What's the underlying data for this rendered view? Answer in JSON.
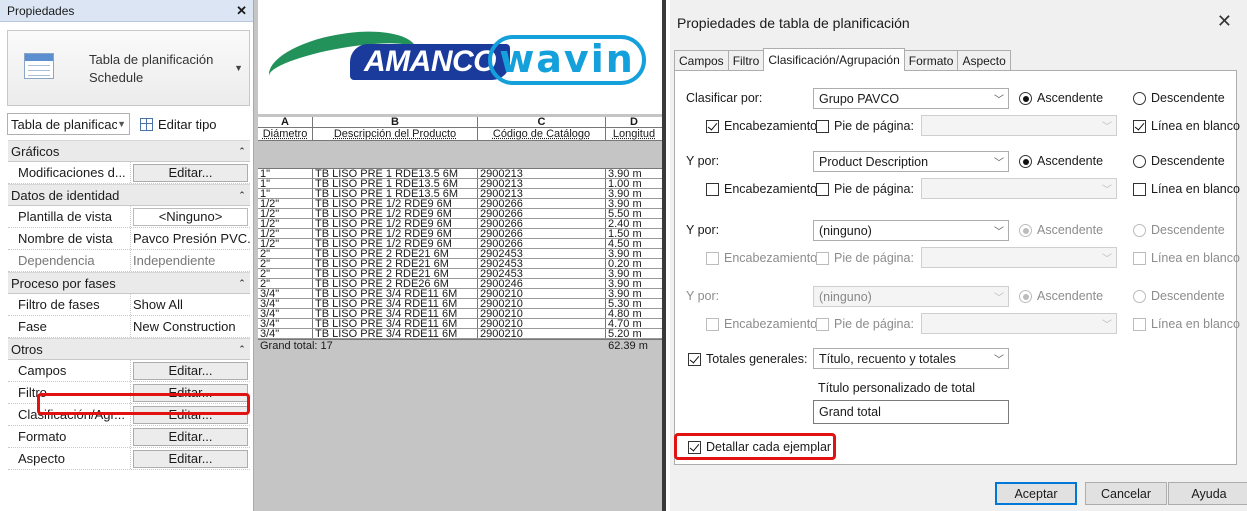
{
  "properties_palette": {
    "title": "Propiedades",
    "type_name_line1": "Tabla de planificación",
    "type_name_line2": "Schedule",
    "instance_selector": "Tabla de planificació",
    "edit_type_label": "Editar tipo",
    "groups": [
      {
        "name": "Gráficos",
        "rows": [
          {
            "name": "Modificaciones d...",
            "value": "Editar...",
            "kind": "button"
          }
        ]
      },
      {
        "name": "Datos de identidad",
        "rows": [
          {
            "name": "Plantilla de vista",
            "value": "<Ninguno>",
            "kind": "button-plain"
          },
          {
            "name": "Nombre de vista",
            "value": "Pavco Presión PVC...",
            "kind": "text"
          },
          {
            "name": "Dependencia",
            "value": "Independiente",
            "kind": "dim"
          }
        ]
      },
      {
        "name": "Proceso por fases",
        "rows": [
          {
            "name": "Filtro de fases",
            "value": "Show All",
            "kind": "text"
          },
          {
            "name": "Fase",
            "value": "New Construction",
            "kind": "text"
          }
        ]
      },
      {
        "name": "Otros",
        "rows": [
          {
            "name": "Campos",
            "value": "Editar...",
            "kind": "button"
          },
          {
            "name": "Filtro",
            "value": "Editar...",
            "kind": "button"
          },
          {
            "name": "Clasificación/Agr...",
            "value": "Editar...",
            "kind": "button"
          },
          {
            "name": "Formato",
            "value": "Editar...",
            "kind": "button"
          },
          {
            "name": "Aspecto",
            "value": "Editar...",
            "kind": "button"
          }
        ]
      }
    ]
  },
  "schedule": {
    "logo_left": "AMANCO",
    "logo_right": "wavin",
    "column_letters": [
      "A",
      "B",
      "C",
      "D"
    ],
    "column_headers": [
      "Diámetro",
      "Descripción del Producto",
      "Código de Catálogo",
      "Longitud"
    ],
    "rows": [
      [
        "1\"",
        "TB LISO PRE 1 RDE13.5 6M",
        "2900213",
        "3.90 m"
      ],
      [
        "1\"",
        "TB LISO PRE 1 RDE13.5 6M",
        "2900213",
        "1.00 m"
      ],
      [
        "1\"",
        "TB LISO PRE 1 RDE13.5 6M",
        "2900213",
        "3.90 m"
      ],
      [
        "1/2\"",
        "TB LISO PRE 1/2 RDE9 6M",
        "2900266",
        "3.90 m"
      ],
      [
        "1/2\"",
        "TB LISO PRE 1/2 RDE9 6M",
        "2900266",
        "5.50 m"
      ],
      [
        "1/2\"",
        "TB LISO PRE 1/2 RDE9 6M",
        "2900266",
        "2.40 m"
      ],
      [
        "1/2\"",
        "TB LISO PRE 1/2 RDE9 6M",
        "2900266",
        "1.50 m"
      ],
      [
        "1/2\"",
        "TB LISO PRE 1/2 RDE9 6M",
        "2900266",
        "4.50 m"
      ],
      [
        "2\"",
        "TB LISO PRE 2 RDE21 6M",
        "2902453",
        "3.90 m"
      ],
      [
        "2\"",
        "TB LISO PRE 2 RDE21 6M",
        "2902453",
        "0.20 m"
      ],
      [
        "2\"",
        "TB LISO PRE 2 RDE21 6M",
        "2902453",
        "3.90 m"
      ],
      [
        "2\"",
        "TB LISO PRE 2 RDE26 6M",
        "2900246",
        "3.90 m"
      ],
      [
        "3/4\"",
        "TB LISO PRE 3/4 RDE11 6M",
        "2900210",
        "3.90 m"
      ],
      [
        "3/4\"",
        "TB LISO PRE 3/4 RDE11 6M",
        "2900210",
        "5.30 m"
      ],
      [
        "3/4\"",
        "TB LISO PRE 3/4 RDE11 6M",
        "2900210",
        "4.80 m"
      ],
      [
        "3/4\"",
        "TB LISO PRE 3/4 RDE11 6M",
        "2900210",
        "4.70 m"
      ],
      [
        "3/4\"",
        "TB LISO PRE 3/4 RDE11 6M",
        "2900210",
        "5.20 m"
      ]
    ],
    "grand_total_label": "Grand total: 17",
    "grand_total_length": "62.39 m"
  },
  "dialog": {
    "title": "Propiedades de tabla de planificación",
    "tabs": [
      "Campos",
      "Filtro",
      "Clasificación/Agrupación",
      "Formato",
      "Aspecto"
    ],
    "active_tab": "Clasificación/Agrupación",
    "sort_rows": [
      {
        "label": "Clasificar por:",
        "value": "Grupo PAVCO",
        "asc": "Ascendente",
        "desc": "Descendente",
        "header": "Encabezamiento",
        "footer": "Pie de página:",
        "blank": "Línea en blanco",
        "header_on": true,
        "footer_on": false,
        "blank_on": true,
        "disabled": false
      },
      {
        "label": "Y por:",
        "value": "Product Description",
        "asc": "Ascendente",
        "desc": "Descendente",
        "header": "Encabezamiento",
        "footer": "Pie de página:",
        "blank": "Línea en blanco",
        "header_on": false,
        "footer_on": false,
        "blank_on": false,
        "disabled": false
      },
      {
        "label": "Y por:",
        "value": "(ninguno)",
        "asc": "Ascendente",
        "desc": "Descendente",
        "header": "Encabezamiento",
        "footer": "Pie de página:",
        "blank": "Línea en blanco",
        "header_on": false,
        "footer_on": false,
        "blank_on": false,
        "disabled": false,
        "partial": true
      },
      {
        "label": "Y por:",
        "value": "(ninguno)",
        "asc": "Ascendente",
        "desc": "Descendente",
        "header": "Encabezamiento",
        "footer": "Pie de página:",
        "blank": "Línea en blanco",
        "header_on": false,
        "footer_on": false,
        "blank_on": false,
        "disabled": true
      }
    ],
    "grand_totals_label": "Totales generales:",
    "grand_totals_value": "Título, recuento y totales",
    "custom_total_title_label": "Título personalizado de total",
    "custom_total_title_value": "Grand total",
    "itemize_label": "Detallar cada ejemplar",
    "buttons": {
      "ok": "Aceptar",
      "cancel": "Cancelar",
      "help": "Ayuda"
    }
  }
}
